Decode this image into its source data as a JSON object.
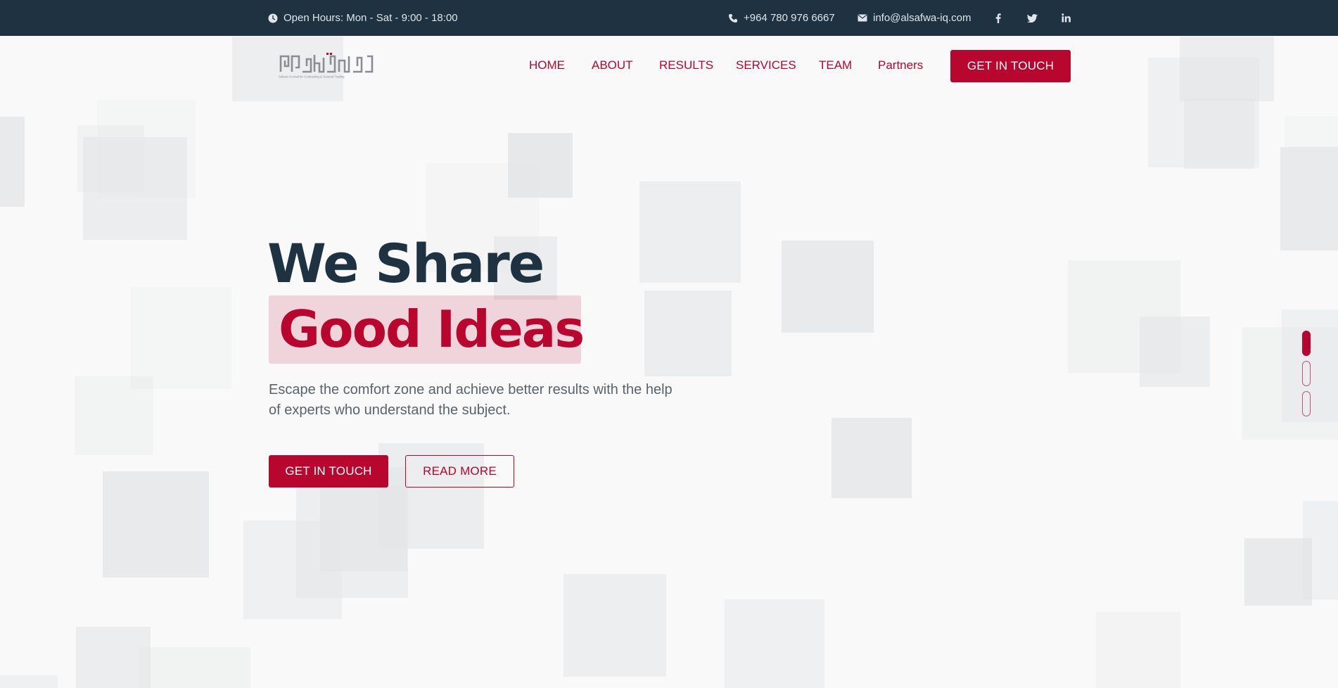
{
  "topbar": {
    "open_hours": "Open Hours: Mon - Sat - 9:00 - 18:00",
    "phone": "+964 780 976 6667",
    "email": "info@alsafwa-iq.com"
  },
  "icons": {
    "clock": "clock-icon",
    "phone": "phone-icon",
    "email": "envelope-icon",
    "facebook": "facebook-icon",
    "twitter": "twitter-icon",
    "linkedin": "linkedin-icon"
  },
  "logo": {
    "caption": "Safwat Al-Amal for Contracting & General Trading"
  },
  "nav": {
    "items": [
      "HOME",
      "ABOUT",
      "RESULTS",
      "SERVICES",
      "TEAM",
      "Partners"
    ],
    "cta": "GET IN TOUCH"
  },
  "hero": {
    "title_line1": "We Share",
    "title_line2": "Good Ideas",
    "subtitle": "Escape the comfort zone and achieve better results with the help of experts who understand the subject.",
    "primary_button": "GET IN TOUCH",
    "secondary_button": "READ MORE"
  },
  "slider": {
    "slide_count": 3,
    "active_index": 0
  },
  "colors": {
    "brand": "#b8062f",
    "topbar_bg": "#1f3241",
    "heading": "#1f3241",
    "page_bg": "#f9f9f9"
  }
}
